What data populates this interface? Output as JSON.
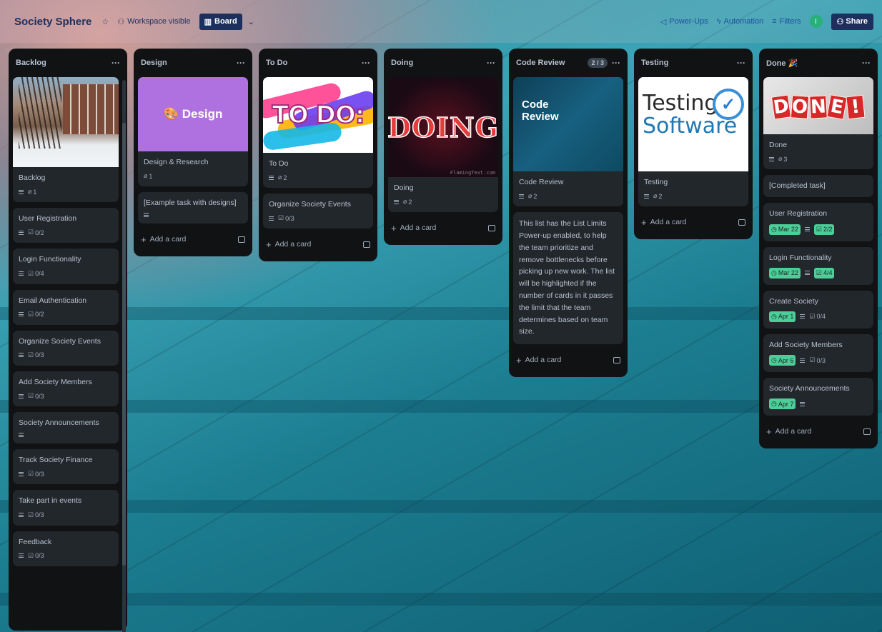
{
  "header": {
    "board_title": "Society Sphere",
    "visibility": "Workspace visible",
    "view": "Board",
    "power_ups": "Power-Ups",
    "automation": "Automation",
    "filters": "Filters",
    "avatar_initial": "I",
    "share": "Share"
  },
  "add_card": "Add a card",
  "lists": {
    "backlog": {
      "title": "Backlog",
      "cards": [
        {
          "title": "Backlog",
          "attachments": "1"
        },
        {
          "title": "User Registration",
          "checklist": "0/2"
        },
        {
          "title": "Login Functionality",
          "checklist": "0/4"
        },
        {
          "title": "Email Authentication",
          "checklist": "0/2"
        },
        {
          "title": "Organize Society Events",
          "checklist": "0/3"
        },
        {
          "title": "Add Society Members",
          "checklist": "0/3"
        },
        {
          "title": "Society Announcements"
        },
        {
          "title": "Track Society Finance",
          "checklist": "0/3"
        },
        {
          "title": "Take part in events",
          "checklist": "0/3"
        },
        {
          "title": "Feedback",
          "checklist": "0/3"
        }
      ]
    },
    "design": {
      "title": "Design",
      "cover_text": "Design",
      "cards": [
        {
          "title": "Design & Research",
          "attachments": "1"
        },
        {
          "title": "[Example task with designs]"
        }
      ]
    },
    "todo": {
      "title": "To Do",
      "cover_text": "TO DO:",
      "cards": [
        {
          "title": "To Do",
          "attachments": "2"
        },
        {
          "title": "Organize Society Events",
          "checklist": "0/3"
        }
      ]
    },
    "doing": {
      "title": "Doing",
      "cover_text": "DOING",
      "cover_watermark": "FlamingText.com",
      "cards": [
        {
          "title": "Doing",
          "attachments": "2"
        }
      ]
    },
    "code_review": {
      "title": "Code Review",
      "limit": "2 / 3",
      "cover_text_1": "Code",
      "cover_text_2": "Review",
      "cards": [
        {
          "title": "Code Review",
          "attachments": "2"
        },
        {
          "title": "This list has the List Limits Power-up enabled, to help the team prioritize and remove bottlenecks before picking up new work. The list will be highlighted if the number of cards in it passes the limit that the team determines based on team size."
        }
      ]
    },
    "testing": {
      "title": "Testing",
      "cover_text_1": "Testing",
      "cover_text_2": "Software",
      "cards": [
        {
          "title": "Testing",
          "attachments": "2"
        }
      ]
    },
    "done": {
      "title": "Done",
      "cover_text": "DONE!",
      "cards": [
        {
          "title": "Done",
          "attachments": "3"
        },
        {
          "title": "[Completed task]"
        },
        {
          "title": "User Registration",
          "due": "Mar 22",
          "checklist": "2/2"
        },
        {
          "title": "Login Functionality",
          "due": "Mar 22",
          "checklist": "4/4"
        },
        {
          "title": "Create Society",
          "due": "Apr 1",
          "checklist": "0/4"
        },
        {
          "title": "Add Society Members",
          "due": "Apr 6",
          "checklist": "0/3"
        },
        {
          "title": "Society Announcements",
          "due": "Apr 7"
        }
      ]
    }
  },
  "colors": {
    "list_bg": "#111214",
    "card_bg": "#22272b",
    "due_green": "#4bce97",
    "header_navy": "#1d2f5c",
    "design_cover": "#b071e0"
  }
}
